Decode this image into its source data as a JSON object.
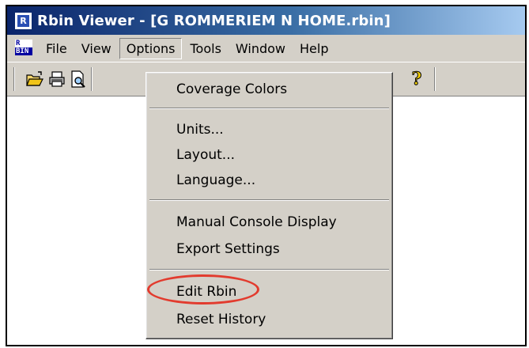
{
  "window": {
    "title": "Rbin Viewer - [G ROMMERIEM N HOME.rbin]",
    "app_icon_letter": "R"
  },
  "menubar": {
    "icon_top": "R",
    "icon_bottom": "BIN",
    "items": [
      {
        "label": "File"
      },
      {
        "label": "View"
      },
      {
        "label": "Options"
      },
      {
        "label": "Tools"
      },
      {
        "label": "Window"
      },
      {
        "label": "Help"
      }
    ]
  },
  "toolbar": {
    "buttons": [
      "open-folder-icon",
      "print-icon",
      "print-preview-icon",
      "help-icon"
    ],
    "help_glyph": "?"
  },
  "options_menu": {
    "items": [
      {
        "label": "Coverage Colors"
      },
      {
        "label": "Units..."
      },
      {
        "label": "Layout..."
      },
      {
        "label": "Language..."
      },
      {
        "label": "Manual Console Display"
      },
      {
        "label": "Export Settings"
      },
      {
        "label": "Edit Rbin"
      },
      {
        "label": "Reset History"
      }
    ]
  },
  "annotation": {
    "highlight_color": "#e23b2e",
    "highlighted_item": "Edit Rbin"
  }
}
